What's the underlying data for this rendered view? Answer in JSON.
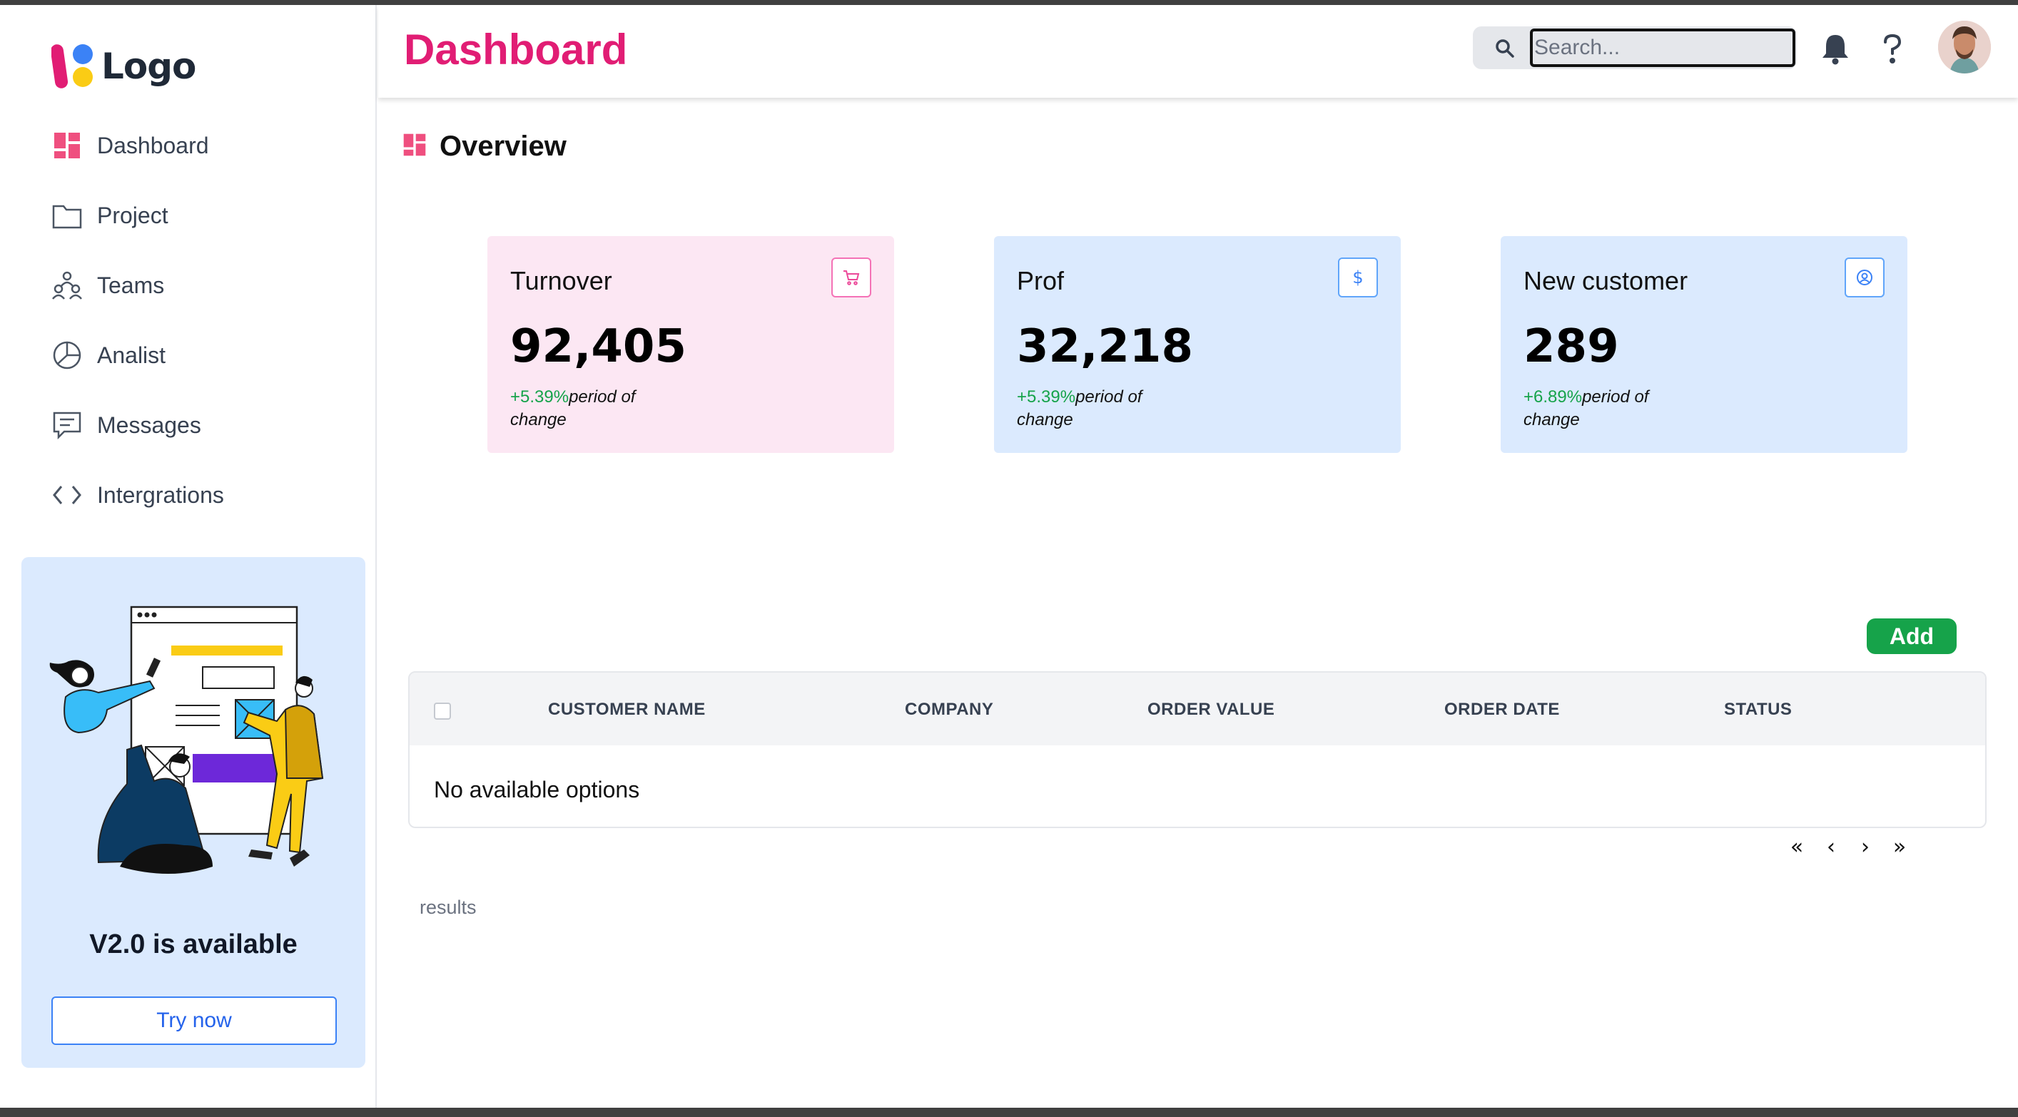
{
  "sidebar": {
    "logo_text": "Logo",
    "items": [
      {
        "label": "Dashboard",
        "icon": "dashboard-grid-icon",
        "active": true
      },
      {
        "label": "Project",
        "icon": "folder-icon"
      },
      {
        "label": "Teams",
        "icon": "teams-icon"
      },
      {
        "label": "Analist",
        "icon": "pie-chart-icon"
      },
      {
        "label": "Messages",
        "icon": "message-icon"
      },
      {
        "label": "Intergrations",
        "icon": "code-icon"
      }
    ],
    "promo": {
      "title": "V2.0 is available",
      "button": "Try now"
    }
  },
  "header": {
    "title": "Dashboard",
    "search_placeholder": "Search...",
    "icons": [
      "search-icon",
      "bell-icon",
      "help-icon",
      "avatar"
    ]
  },
  "overview": {
    "label": "Overview",
    "cards": [
      {
        "title": "Turnover",
        "value": "92,405",
        "change": "+5.39%",
        "note": "period of change",
        "icon": "cart-icon",
        "theme": "pink"
      },
      {
        "title": "Prof",
        "value": "32,218",
        "change": "+5.39%",
        "note": "period of change",
        "icon": "dollar-icon",
        "theme": "blue"
      },
      {
        "title": "New customer",
        "value": "289",
        "change": "+6.89%",
        "note": "period of change",
        "icon": "user-circle-icon",
        "theme": "blue"
      }
    ]
  },
  "table": {
    "add_label": "Add",
    "columns": [
      "CUSTOMER NAME",
      "COMPANY",
      "ORDER VALUE",
      "ORDER DATE",
      "STATUS"
    ],
    "empty_text": "No available options",
    "pagination": [
      "«",
      "‹",
      "›",
      "»"
    ],
    "results_label": "results"
  },
  "colors": {
    "accent_pink": "#e11d74",
    "card_pink": "#fce7f3",
    "card_blue": "#dbeafe",
    "positive": "#16a34a",
    "add_button": "#16a34a"
  }
}
